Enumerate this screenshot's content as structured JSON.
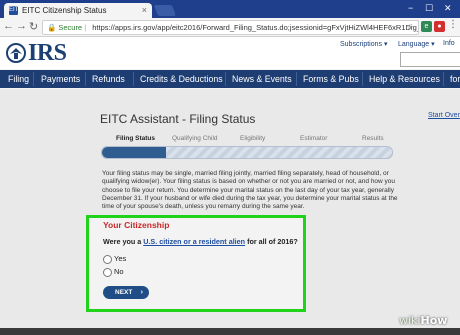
{
  "browser": {
    "tab_title": "EITC Citizenship Status",
    "tab_close": "×",
    "favicon_text": "EITC",
    "secure_label": "Secure",
    "url": "https://apps.irs.gov/app/eitc2016/Forward_Filing_Status.do;jsessionid=gFxVjtHiZWl4HEF6xR1Dig_...",
    "window_controls": [
      "−",
      "☐",
      "✕"
    ],
    "nav_icons": [
      "←",
      "→",
      "↻"
    ],
    "ext_icons": [
      {
        "name": "evernote",
        "color": "#2e8b57"
      },
      {
        "name": "adblock",
        "color": "#d32f2f"
      },
      {
        "name": "extension",
        "color": "#4a4a9a"
      }
    ]
  },
  "irs": {
    "logo_text": "IRS",
    "util_links": [
      "Subscriptions ▾",
      "Language ▾",
      "Info"
    ],
    "nav": [
      "Filing",
      "Payments",
      "Refunds",
      "Credits & Deductions",
      "News & Events",
      "Forms & Pubs",
      "Help & Resources",
      "for"
    ]
  },
  "eitc": {
    "title": "EITC Assistant - Filing Status",
    "start_over": "Start Over",
    "steps": [
      "Filing Status",
      "Qualifying Child",
      "Eligibility",
      "Estimator",
      "Results"
    ],
    "active_step": 0,
    "progress_fraction": 0.22,
    "intro": "Your filing status may be single, married filing jointly, married filing separately, head of household, or qualifying widow(er). Your filing status is based on whether or not you are married or not, and how you choose to file your return. You determine your marital status on the last day of your tax year, generally December 31. If your husband or wife died during the tax year, you determine your marital status at the time of your spouse's death, unless you remarry during the same year.",
    "citizenship": {
      "heading": "Your Citizenship",
      "question_pre": "Were you a ",
      "question_link": "U.S. citizen or a resident alien",
      "question_post": " for all of 2016?",
      "options": [
        "Yes",
        "No"
      ],
      "next_label": "NEXT",
      "next_arrow": "›"
    }
  },
  "watermark": {
    "wiki": "wiki",
    "how": "How"
  },
  "colors": {
    "tab_bar": "#1f3f8c",
    "irs_navy": "#1e3d72",
    "highlight_green": "#21d21b",
    "heading_red": "#c62828",
    "button_blue": "#1f4e86"
  }
}
